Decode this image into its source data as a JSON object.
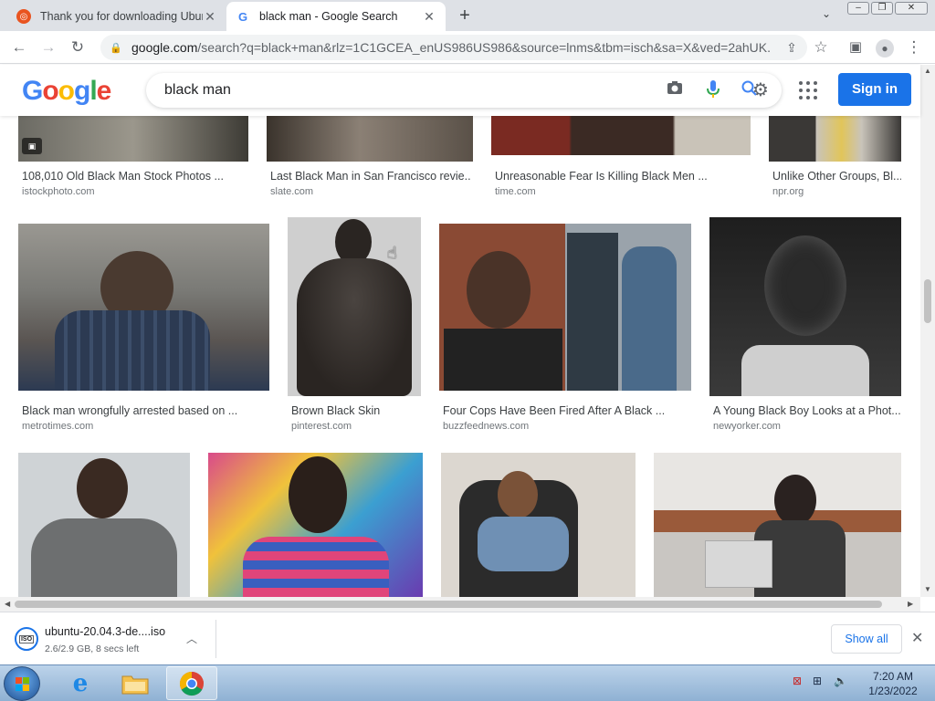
{
  "browser": {
    "tabs": [
      {
        "title": "Thank you for downloading Ubun",
        "favicon": "ubuntu-icon",
        "active": false
      },
      {
        "title": "black man - Google Search",
        "favicon": "google-icon",
        "active": true
      }
    ],
    "new_tab": "+",
    "url_host": "google.com",
    "url_rest": "/search?q=black+man&rlz=1C1GCEA_enUS986US986&source=lnms&tbm=isch&sa=X&ved=2ahUK..."
  },
  "google": {
    "logo": [
      "G",
      "o",
      "o",
      "g",
      "l",
      "e"
    ],
    "logo_colors": [
      "#4285f4",
      "#ea4335",
      "#fbbc05",
      "#4285f4",
      "#34a853",
      "#ea4335"
    ],
    "query": "black man",
    "sign_in": "Sign in"
  },
  "results": [
    {
      "caption": "108,010 Old Black Man Stock Photos ...",
      "source": "istockphoto.com",
      "colors": [
        "#6b6a63",
        "#9b978c",
        "#3d3b35"
      ]
    },
    {
      "caption": "Last Black Man in San Francisco revie...",
      "source": "slate.com",
      "colors": [
        "#5a5148",
        "#8b8075",
        "#3a332c"
      ]
    },
    {
      "caption": "Unreasonable Fear Is Killing Black Men ...",
      "source": "time.com",
      "colors": [
        "#7a2a22",
        "#3b2a24",
        "#c9c3b8"
      ]
    },
    {
      "caption": "Unlike Other Groups, Bl...",
      "source": "npr.org",
      "colors": [
        "#3a3836",
        "#c9c4ba",
        "#e1c55a"
      ]
    },
    {
      "caption": "Black man wrongfully arrested based on ...",
      "source": "metrotimes.com",
      "colors": [
        "#8c8a84",
        "#2c3a52",
        "#4a3a30"
      ]
    },
    {
      "caption": "Brown Black Skin",
      "source": "pinterest.com",
      "colors": [
        "#cfcfcf",
        "#2a2522",
        "#4a4440"
      ]
    },
    {
      "caption": "Four Cops Have Been Fired After A Black ...",
      "source": "buzzfeednews.com",
      "colors": [
        "#8a4a34",
        "#2f3a44",
        "#9aa3ab"
      ]
    },
    {
      "caption": "A Young Black Boy Looks at a Phot...",
      "source": "newyorker.com",
      "colors": [
        "#1e1e1e",
        "#5a5a5a",
        "#cfcfcf"
      ]
    },
    {
      "caption": "",
      "source": "",
      "colors": [
        "#cfd3d6",
        "#6d6f70",
        "#3a2a22"
      ]
    },
    {
      "caption": "",
      "source": "",
      "colors": [
        "#d94b8a",
        "#3b9fd1",
        "#2a1f1a"
      ]
    },
    {
      "caption": "",
      "source": "",
      "colors": [
        "#dcd7d0",
        "#2b2b2b",
        "#6f90b4"
      ]
    },
    {
      "caption": "",
      "source": "",
      "colors": [
        "#e8e6e3",
        "#9a5a3a",
        "#3a3a3a"
      ]
    }
  ],
  "download": {
    "filename": "ubuntu-20.04.3-de....iso",
    "status": "2.6/2.9 GB, 8 secs left",
    "file_type": "ISO",
    "show_all": "Show all"
  },
  "taskbar": {
    "time": "7:20 AM",
    "date": "1/23/2022"
  }
}
